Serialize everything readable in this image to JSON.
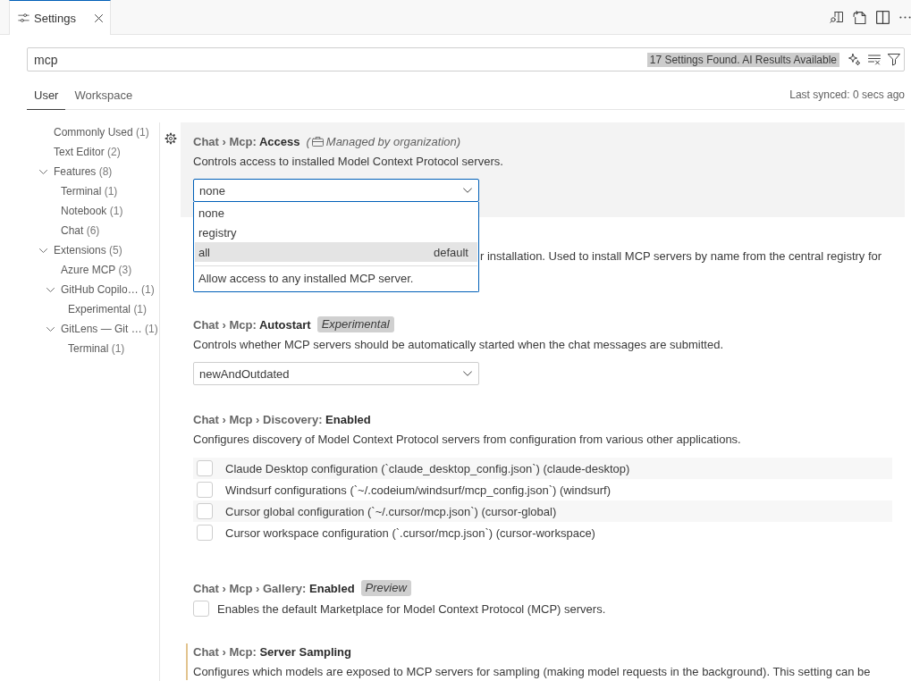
{
  "editor_tab": {
    "label": "Settings"
  },
  "search": {
    "value": "mcp",
    "result_badge": "17 Settings Found. AI Results Available"
  },
  "scope_tabs": [
    {
      "label": "User",
      "selected": true
    },
    {
      "label": "Workspace",
      "selected": false
    }
  ],
  "last_synced": "Last synced: 0 secs ago",
  "toc": [
    {
      "label": "Commonly Used",
      "count": "(1)"
    },
    {
      "label": "Text Editor",
      "count": "(2)"
    },
    {
      "label": "Features",
      "count": "(8)",
      "expanded": true,
      "children": [
        {
          "label": "Terminal",
          "count": "(1)"
        },
        {
          "label": "Notebook",
          "count": "(1)"
        },
        {
          "label": "Chat",
          "count": "(6)"
        }
      ]
    },
    {
      "label": "Extensions",
      "count": "(5)",
      "expanded": true,
      "children": [
        {
          "label": "Azure MCP",
          "count": "(3)"
        },
        {
          "label": "GitHub Copilo…",
          "count": "(1)",
          "expanded": true,
          "children": [
            {
              "label": "Experimental",
              "count": "(1)"
            }
          ]
        },
        {
          "label": "GitLens — Git …",
          "count": "(1)",
          "expanded": true,
          "children": [
            {
              "label": "Terminal",
              "count": "(1)"
            }
          ]
        }
      ]
    }
  ],
  "settings": [
    {
      "kind": "dropdown",
      "focused": true,
      "modified": false,
      "title": "Chat › Mcp: **Access**",
      "note_open": "(",
      "note": "Managed by organization)",
      "description": "Controls access to installed Model Context Protocol servers.",
      "value": "none",
      "open": true,
      "options": [
        {
          "label": "none",
          "highlighted": false
        },
        {
          "label": "registry",
          "highlighted": false
        },
        {
          "label": "all",
          "highlighted": true,
          "detail": "default"
        }
      ],
      "option_description": "Allow access to any installed MCP server."
    },
    {
      "kind": "covered",
      "focused": false,
      "modified": false,
      "description": "r installation. Used to install MCP servers by name from the central registry for"
    },
    {
      "kind": "dropdown",
      "focused": false,
      "modified": false,
      "title": "Chat › Mcp: **Autostart**",
      "tag": "Experimental",
      "description": "Controls whether MCP servers should be automatically started when the chat messages are submitted.",
      "value": "newAndOutdated",
      "open": false
    },
    {
      "kind": "checkbox_list",
      "focused": false,
      "modified": false,
      "title": "Chat › Mcp › Discovery: **Enabled**",
      "description": "Configures discovery of Model Context Protocol servers from configuration from various other applications.",
      "items": [
        {
          "label": "Claude Desktop configuration (`claude_desktop_config.json`) (claude-desktop)",
          "checked": false
        },
        {
          "label": "Windsurf configurations (`~/.codeium/windsurf/mcp_config.json`) (windsurf)",
          "checked": false
        },
        {
          "label": "Cursor global configuration (`~/.cursor/mcp.json`) (cursor-global)",
          "checked": false
        },
        {
          "label": "Cursor workspace configuration (`.cursor/mcp.json`) (cursor-workspace)",
          "checked": false
        }
      ]
    },
    {
      "kind": "checkbox",
      "focused": false,
      "modified": false,
      "title": "Chat › Mcp › Gallery: **Enabled**",
      "tag": "Preview",
      "checked": false,
      "description": "Enables the default Marketplace for Model Context Protocol (MCP) servers."
    },
    {
      "kind": "text",
      "focused": false,
      "modified": true,
      "title": "Chat › Mcp: **Server Sampling**",
      "description": "Configures which models are exposed to MCP servers for sampling (making model requests in the background). This setting can be"
    }
  ]
}
